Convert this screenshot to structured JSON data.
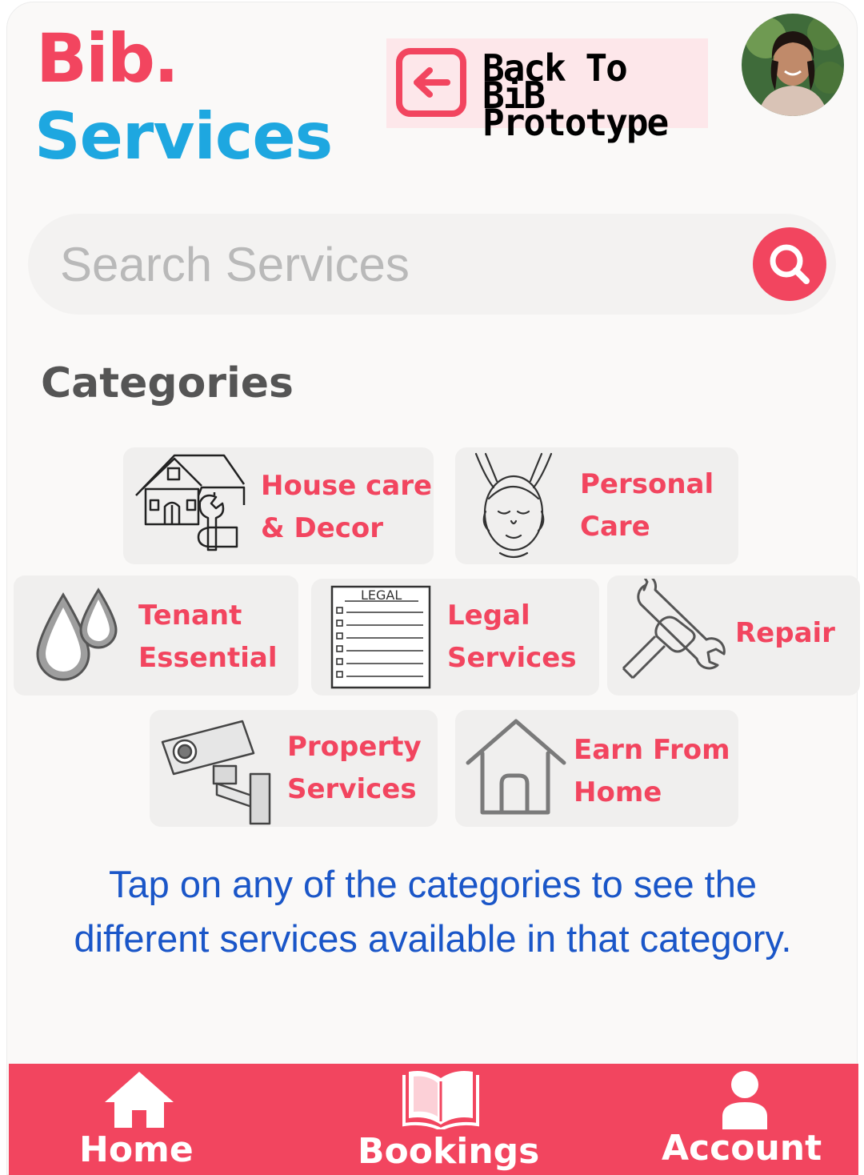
{
  "header": {
    "brand_line1": "Bib.",
    "brand_line2": "Services",
    "back_button_label": "Back To BiB Prototype"
  },
  "search": {
    "placeholder": "Search Services"
  },
  "categories_title": "Categories",
  "categories": [
    {
      "label": "House care\n& Decor",
      "icon": "house-repair-icon"
    },
    {
      "label": "Personal\nCare",
      "icon": "face-massage-icon"
    },
    {
      "label": "Tenant\nEssential",
      "icon": "water-drops-icon"
    },
    {
      "label": "Legal\nServices",
      "icon": "legal-document-icon"
    },
    {
      "label": "Repair",
      "icon": "wrench-hand-icon"
    },
    {
      "label": "Property\nServices",
      "icon": "cctv-camera-icon"
    },
    {
      "label": "Earn From\nHome",
      "icon": "home-outline-icon"
    }
  ],
  "hint_text": "Tap on any of the categories to see the different services available in that category.",
  "bottom_nav": [
    {
      "label": "Home",
      "icon": "home-icon"
    },
    {
      "label": "Bookings",
      "icon": "book-icon"
    },
    {
      "label": "Account",
      "icon": "user-icon"
    }
  ],
  "colors": {
    "accent": "#f2455f",
    "brand_blue": "#1ea7e0",
    "hint_blue": "#1a56c8",
    "card_bg": "#f0efee"
  }
}
